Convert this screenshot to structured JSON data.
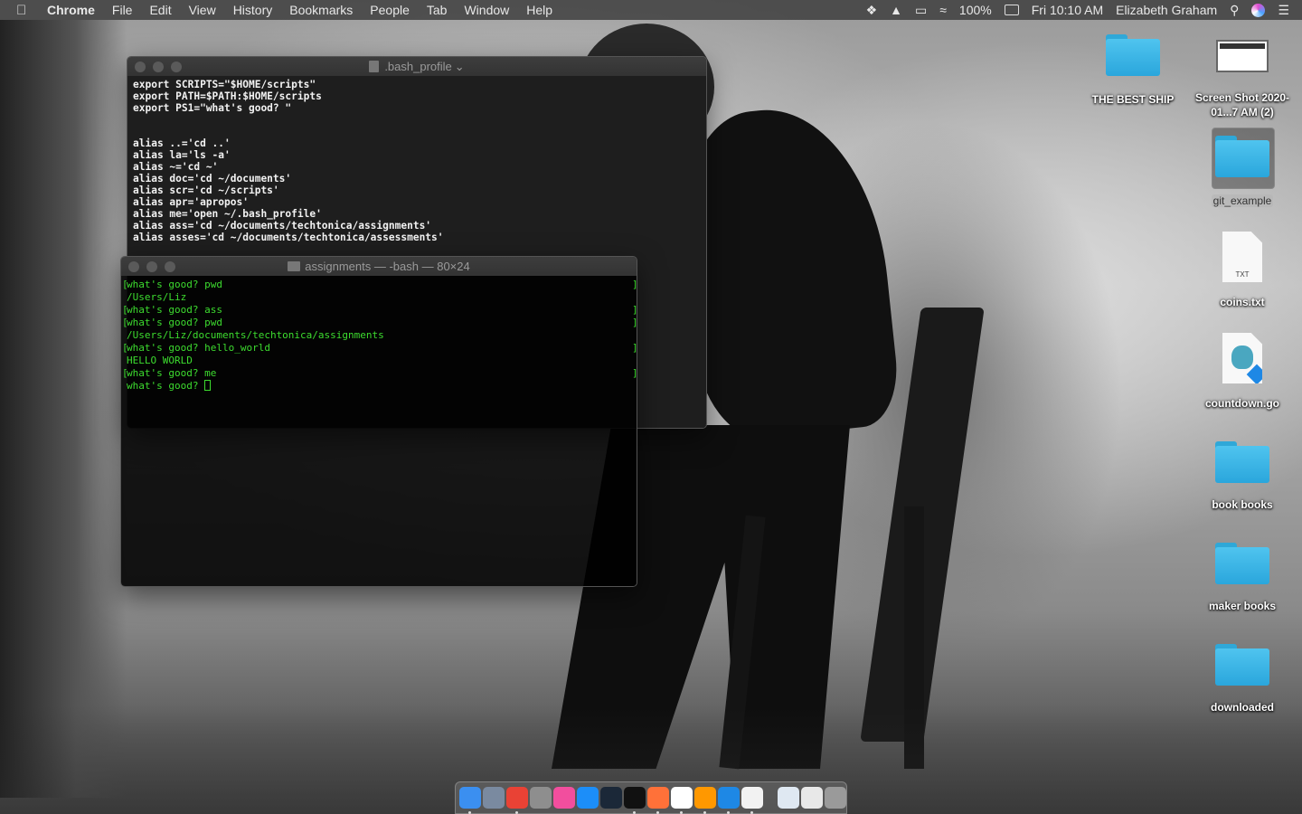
{
  "menubar": {
    "app_name": "Chrome",
    "items": [
      "File",
      "Edit",
      "View",
      "History",
      "Bookmarks",
      "People",
      "Tab",
      "Window",
      "Help"
    ],
    "battery": "100%",
    "clock": "Fri 10:10 AM",
    "user": "Elizabeth Graham"
  },
  "editor_window": {
    "title": ".bash_profile",
    "title_suffix": "⌄",
    "lines": [
      "export SCRIPTS=\"$HOME/scripts\"",
      "export PATH=$PATH:$HOME/scripts",
      "export PS1=\"what's good? \"",
      "",
      "",
      "alias ..='cd ..'",
      "alias la='ls -a'",
      "alias ~='cd ~'",
      "alias doc='cd ~/documents'",
      "alias scr='cd ~/scripts'",
      "alias apr='apropos'",
      "alias me='open ~/.bash_profile'",
      "alias ass='cd ~/documents/techtonica/assignments'",
      "alias asses='cd ~/documents/techtonica/assessments'"
    ]
  },
  "terminal_window": {
    "title": "assignments — -bash — 80×24",
    "lines": [
      {
        "text": "what's good? pwd",
        "bracket": true
      },
      {
        "text": "/Users/Liz",
        "bracket": false
      },
      {
        "text": "what's good? ass",
        "bracket": true
      },
      {
        "text": "what's good? pwd",
        "bracket": true
      },
      {
        "text": "/Users/Liz/documents/techtonica/assignments",
        "bracket": false
      },
      {
        "text": "what's good? hello_world",
        "bracket": true
      },
      {
        "text": "HELLO WORLD",
        "bracket": false
      },
      {
        "text": "what's good? me",
        "bracket": true
      }
    ],
    "prompt": "what's good? "
  },
  "desktop": {
    "icons": [
      {
        "label": "THE BEST SHIP",
        "kind": "folder"
      },
      {
        "label": "Screen Shot 2020-01...7 AM (2)",
        "kind": "screenshot"
      },
      {
        "label": "git_example",
        "kind": "folder",
        "selected": true
      },
      {
        "label": "coins.txt",
        "kind": "txt",
        "badge": "TXT"
      },
      {
        "label": "countdown.go",
        "kind": "go"
      },
      {
        "label": "book books",
        "kind": "folder"
      },
      {
        "label": "maker books",
        "kind": "folder"
      },
      {
        "label": "downloaded",
        "kind": "folder"
      }
    ]
  },
  "dock": {
    "apps": [
      {
        "name": "finder-icon",
        "color": "#3b8ff0",
        "running": true
      },
      {
        "name": "launchpad-icon",
        "color": "#7a8aa0",
        "running": false
      },
      {
        "name": "chrome-icon",
        "color": "#e94235",
        "running": true
      },
      {
        "name": "system-preferences-icon",
        "color": "#8e8e8e",
        "running": false
      },
      {
        "name": "itunes-icon",
        "color": "#f24e9e",
        "running": false
      },
      {
        "name": "app-store-icon",
        "color": "#1c8ef9",
        "running": false
      },
      {
        "name": "steam-icon",
        "color": "#1b2838",
        "running": false
      },
      {
        "name": "terminal-icon",
        "color": "#111111",
        "running": true
      },
      {
        "name": "firefox-icon",
        "color": "#ff7139",
        "running": true
      },
      {
        "name": "slack-icon",
        "color": "#ffffff",
        "running": true
      },
      {
        "name": "sublime-text-icon",
        "color": "#ff9800",
        "running": true
      },
      {
        "name": "vscode-icon",
        "color": "#1e88e5",
        "running": true
      },
      {
        "name": "textedit-icon",
        "color": "#f2f2f2",
        "running": true
      }
    ],
    "extras": [
      {
        "name": "documents-stack-icon",
        "color": "#dfe8f2"
      },
      {
        "name": "downloads-stack-icon",
        "color": "#e8e8e8"
      },
      {
        "name": "trash-icon",
        "color": "#9a9a9a"
      }
    ]
  }
}
